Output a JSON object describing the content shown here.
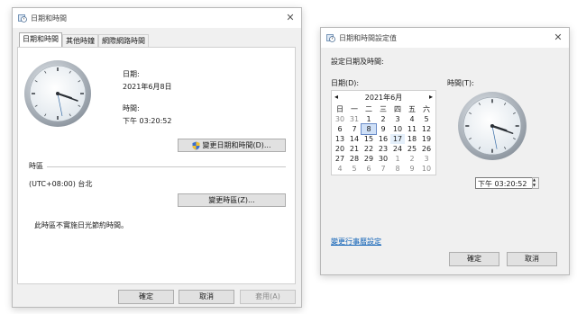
{
  "left_window": {
    "title": "日期和時間",
    "tabs": [
      "日期和時間",
      "其他時鐘",
      "網際網路時間"
    ],
    "date_label": "日期:",
    "date_value": "2021年6月8日",
    "time_label": "時間:",
    "time_value": "下午 03:20:52",
    "change_datetime_button": "變更日期和時間(D)...",
    "timezone_section_label": "時區",
    "timezone_value": "(UTC+08:00) 台北",
    "change_timezone_button": "變更時區(Z)...",
    "dst_note": "此時區不實施日光節約時間。",
    "ok_button": "確定",
    "cancel_button": "取消",
    "apply_button": "套用(A)"
  },
  "right_window": {
    "title": "日期和時間設定值",
    "heading": "設定日期及時間:",
    "date_label": "日期(D):",
    "time_label": "時間(T):",
    "calendar": {
      "month_label": "2021年6月",
      "prev_arrow": "◂",
      "next_arrow": "▸",
      "weekdays": [
        "日",
        "一",
        "二",
        "三",
        "四",
        "五",
        "六"
      ],
      "weeks": [
        [
          "30",
          "31",
          "1",
          "2",
          "3",
          "4",
          "5"
        ],
        [
          "6",
          "7",
          "8",
          "9",
          "10",
          "11",
          "12"
        ],
        [
          "13",
          "14",
          "15",
          "16",
          "17",
          "18",
          "19"
        ],
        [
          "20",
          "21",
          "22",
          "23",
          "24",
          "25",
          "26"
        ],
        [
          "27",
          "28",
          "29",
          "30",
          "1",
          "2",
          "3"
        ],
        [
          "4",
          "5",
          "6",
          "7",
          "8",
          "9",
          "10"
        ]
      ],
      "selected_day": "8"
    },
    "time_value": "下午 03:20:52",
    "change_calendar_link": "變更行事曆設定",
    "ok_button": "確定",
    "cancel_button": "取消"
  },
  "icons": {
    "title_icon": "calendar-clock-icon",
    "close_icon": "close-icon",
    "shield_icon": "uac-shield-icon",
    "spinner_up": "▲",
    "spinner_down": "▼"
  },
  "colors": {
    "accent": "#0b5fb6",
    "window_bg": "#f0f0f0",
    "selection": "#cfe0f7"
  }
}
